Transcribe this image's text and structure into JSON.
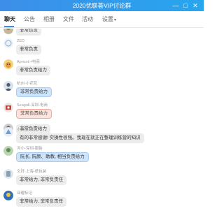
{
  "window": {
    "title": "2020优联荟VIP讨论群",
    "minimize_glyph": "—",
    "maximize_glyph": "□",
    "close_glyph": "✕"
  },
  "tabs": [
    {
      "label": "聊天",
      "active": true
    },
    {
      "label": "公告"
    },
    {
      "label": "相册"
    },
    {
      "label": "文件"
    },
    {
      "label": "活动"
    },
    {
      "label": "设置"
    }
  ],
  "settings_caret": "▾",
  "messages": [
    {
      "sender": "",
      "text": "非常负责"
    },
    {
      "sender": "ZED",
      "text": "非常负责"
    },
    {
      "sender": "Apricot:+电商",
      "text": "非常负责给力"
    },
    {
      "sender": "杭州-小花花",
      "text": "非常负责给力"
    },
    {
      "sender": "Seagull-深圳-电商",
      "text": "非常负责给力"
    },
    {
      "sender": "",
      "text": "非常负责给力"
    },
    {
      "sender": "小度梦-深圳",
      "text": "有的非常感谢! 实操性很强。我现在就正在整理训练营的知识"
    },
    {
      "sender": "冯小-深圳-服装",
      "text": "阮长, 阮颜、助教, 相当负责给力"
    },
    {
      "sender": "文好-上海-纸包装",
      "text": "非常给力, 非常负责任"
    },
    {
      "sender": "亚耀标记",
      "text": "非常给力, 非常负责任"
    }
  ],
  "colors": {
    "titlebar": "#2f9bec",
    "accent": "#3a8fe8",
    "bubble_default": "#ececec",
    "bubble_highlight": "#cde4fb",
    "bubble_red": "#fde3dc"
  }
}
